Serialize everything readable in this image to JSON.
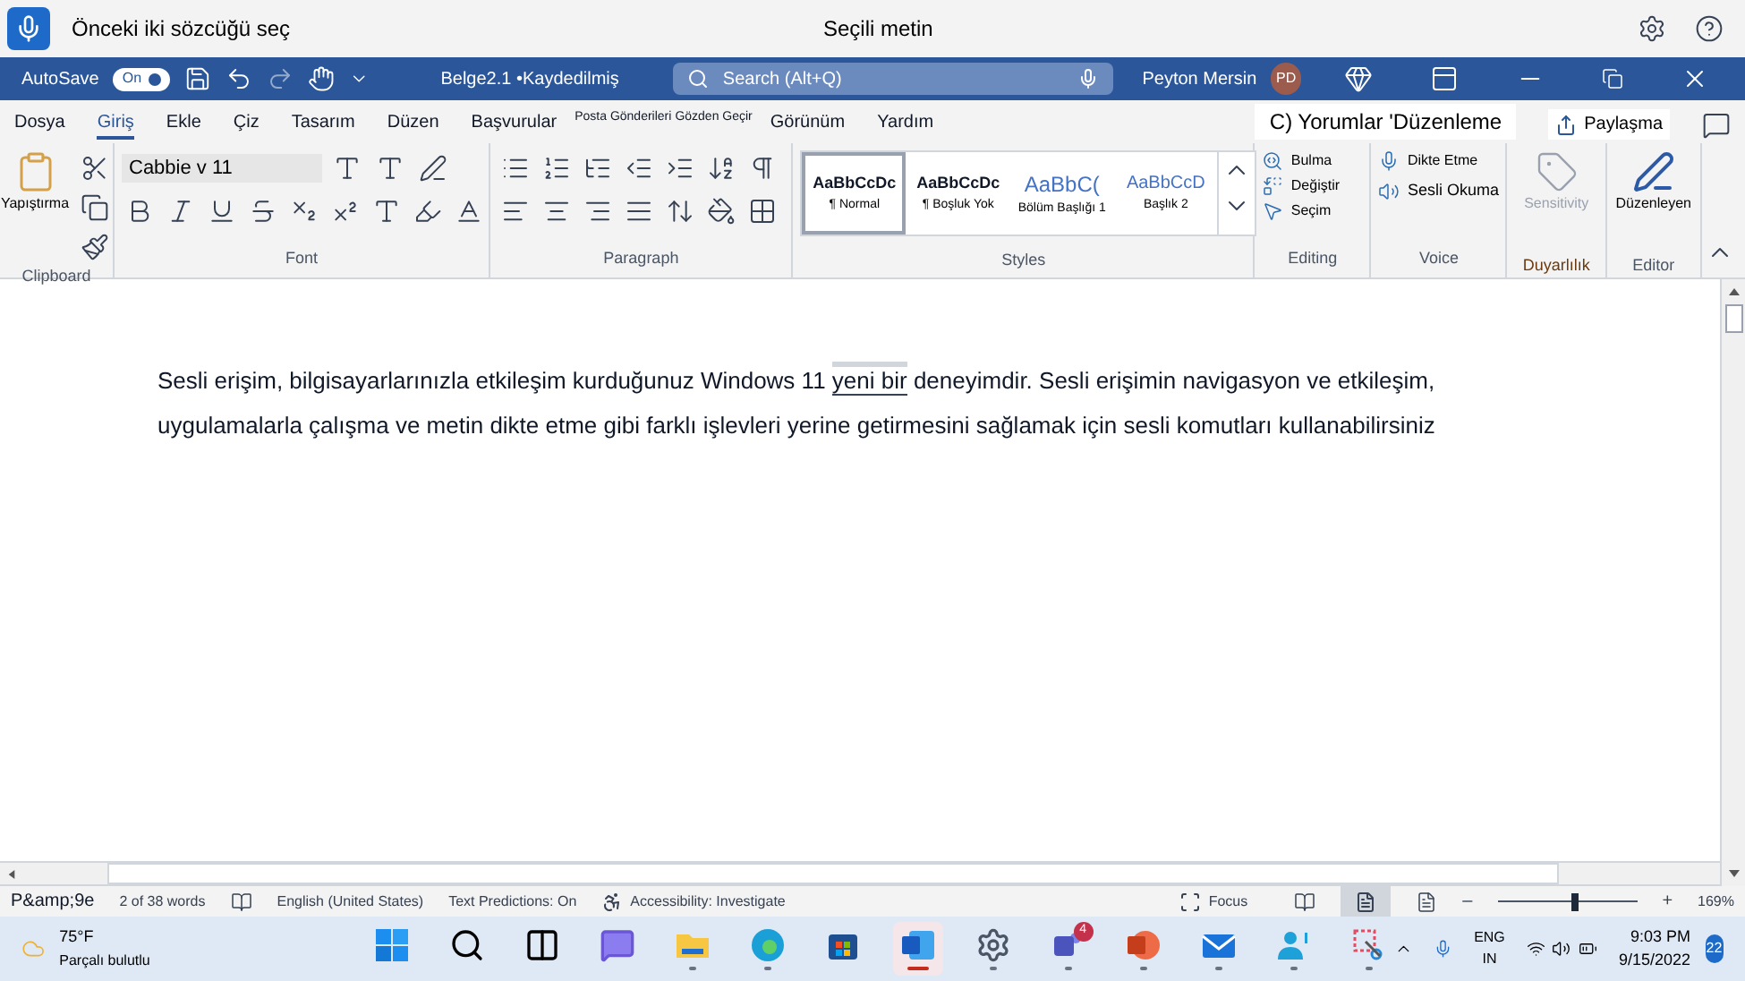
{
  "voice_bar": {
    "hint": "Önceki iki sözcüğü seç",
    "status": "Seçili metin"
  },
  "title_bar": {
    "autosave": "AutoSave",
    "autosave_toggle": "On",
    "autosave_on": true,
    "doc_title": "Belge2.1 •Kaydedilmiş",
    "search_placeholder": "Search (Alt+Q)",
    "user_name": "Peyton Mersin",
    "user_initials": "PD"
  },
  "tabs": [
    {
      "label": "Dosya",
      "selected": false,
      "kind": "normal"
    },
    {
      "label": "Giriş",
      "selected": true,
      "kind": "normal"
    },
    {
      "label": "Ekle",
      "selected": false,
      "kind": "normal"
    },
    {
      "label": "Çiz",
      "selected": false,
      "kind": "normal"
    },
    {
      "label": "Tasarım",
      "selected": false,
      "kind": "normal"
    },
    {
      "label": "Düzen",
      "selected": false,
      "kind": "normal"
    },
    {
      "label": "Başvurular",
      "selected": false,
      "kind": "normal"
    },
    {
      "label": "Posta Gönderileri",
      "selected": false,
      "kind": "small"
    },
    {
      "label": "Gözden Geçir",
      "selected": false,
      "kind": "small"
    },
    {
      "label": "Görünüm",
      "selected": false,
      "kind": "normal"
    },
    {
      "label": "Yardım",
      "selected": false,
      "kind": "normal"
    }
  ],
  "comments_button": "C) Yorumlar 'Düzenleme",
  "share_button": "Paylaşma",
  "ribbon": {
    "paste": "Yapıştırma",
    "font_name": "Cabbie v 11",
    "styles": [
      {
        "preview": "AaBbCcDc",
        "name": "¶ Normal",
        "selected": true,
        "kind": "body"
      },
      {
        "preview": "AaBbCcDc",
        "name": "¶ Boşluk Yok",
        "selected": false,
        "kind": "body"
      },
      {
        "preview": "AaBbC(",
        "name": "Bölüm Başlığı 1",
        "selected": false,
        "kind": "heading1"
      },
      {
        "preview": "AaBbCcD",
        "name": "Başlık 2",
        "selected": false,
        "kind": "heading2"
      }
    ],
    "editing": [
      "Bulma",
      "Değiştir",
      "Seçim"
    ],
    "voice": [
      "Dikte Etme",
      "Sesli Okuma"
    ],
    "sensitivity": {
      "label": "Sensitivity",
      "disabled": true
    },
    "editor": "Düzenleyen",
    "group_labels": [
      "Clipboard",
      "Font",
      "Paragraph",
      "Styles",
      "Editing",
      "Voice",
      "Duyarlılık",
      "Editor"
    ]
  },
  "document": {
    "before": "Sesli erişim, bilgisayarlarınızla etkileşim kurduğunuz Windows 11 ",
    "selection": "yeni bir",
    "after": " deneyimdir. Sesli erişimin navigasyon ve etkileşim, uygulamalarla çalışma ve metin dikte etme gibi farklı işlevleri yerine getirmesini sağlamak için sesli komutları kullanabilirsiniz"
  },
  "status_bar": {
    "page": "P&amp;9e",
    "words": "2 of 38 words",
    "language": "English (United States)",
    "predictions": "Text Predictions: On",
    "accessibility": "Accessibility: Investigate",
    "focus": "Focus",
    "zoom_out": "–",
    "zoom_in": "+",
    "zoom": "169%",
    "zoom_level": {
      "level": 0.55
    }
  },
  "taskbar": {
    "temperature": "75°F",
    "weather": "Parçalı bulutlu",
    "apps": [
      {
        "kind": "start",
        "active": false
      },
      {
        "kind": "search",
        "active": false
      },
      {
        "kind": "taskview",
        "active": false
      },
      {
        "kind": "chat",
        "active": false
      },
      {
        "kind": "explorer",
        "active": true
      },
      {
        "kind": "edge",
        "active": true
      },
      {
        "kind": "store",
        "active": false
      },
      {
        "kind": "word",
        "active": true,
        "selected": true
      },
      {
        "kind": "settings",
        "active": true
      },
      {
        "kind": "teams",
        "active": true,
        "badge": "4"
      },
      {
        "kind": "powerpoint",
        "active": true
      },
      {
        "kind": "mail",
        "active": true
      },
      {
        "kind": "voice",
        "active": true
      },
      {
        "kind": "snip",
        "active": true
      }
    ],
    "lang": "ENG",
    "region": "IN",
    "time": "9:03 PM",
    "date": "9/15/2022",
    "notifications": "22"
  }
}
